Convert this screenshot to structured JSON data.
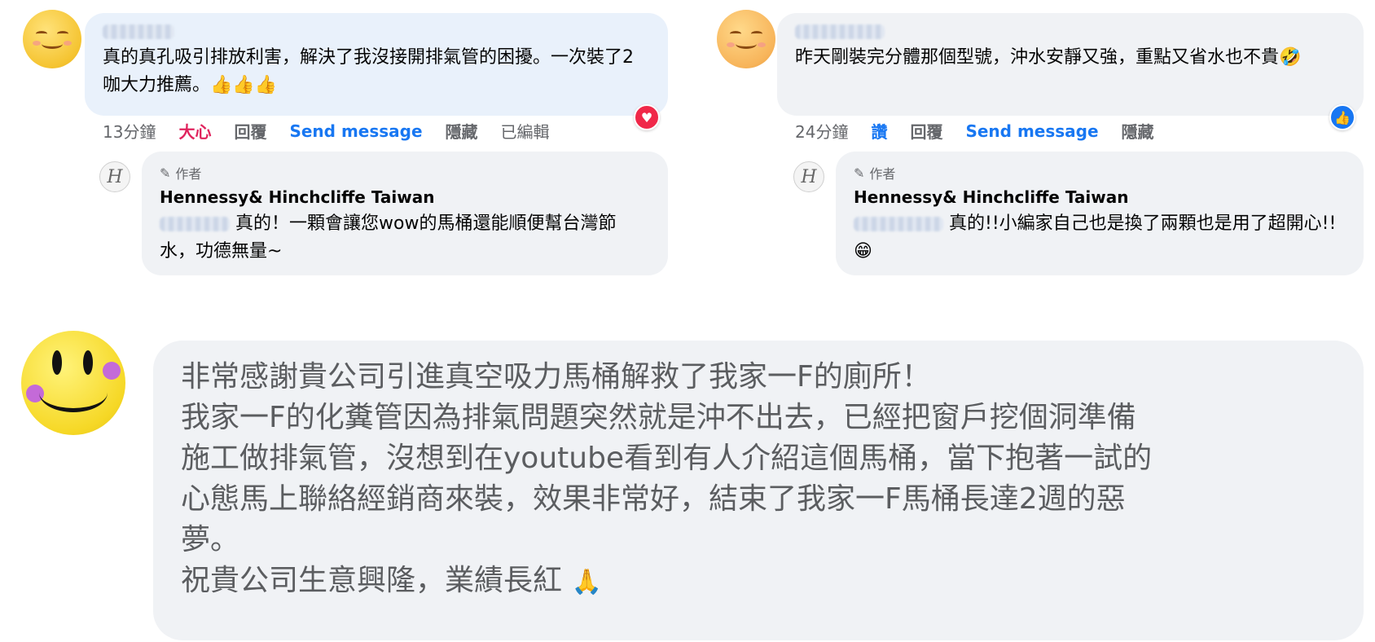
{
  "comments": [
    {
      "text": "真的真孔吸引排放利害，解決了我沒接開排氣管的困擾。一次裝了2咖大力推薦。👍👍👍",
      "time": "13分鐘",
      "reaction_label": "大心",
      "reply_label": "回覆",
      "send_label": "Send message",
      "hide_label": "隱藏",
      "edited_label": "已編輯",
      "reaction_badge": "heart-icon"
    },
    {
      "text": "昨天剛裝完分體那個型號，沖水安靜又強，重點又省水也不貴🤣",
      "time": "24分鐘",
      "reaction_label": "讚",
      "reply_label": "回覆",
      "send_label": "Send message",
      "hide_label": "隱藏",
      "reaction_badge": "thumbs-up-icon"
    }
  ],
  "replies": [
    {
      "author_badge": "作者",
      "page_name": "Hennessy& Hinchcliffe Taiwan",
      "text": "真的！一顆會讓您wow的馬桶還能順便幫台灣節水，功德無量~"
    },
    {
      "author_badge": "作者",
      "page_name": "Hennessy& Hinchcliffe Taiwan",
      "text": "真的!!小編家自己也是換了兩顆也是用了超開心!!😁"
    }
  ],
  "big_comment": {
    "lines": [
      "非常感謝貴公司引進真空吸力馬桶解救了我家一F的廁所！",
      "我家一F的化糞管因為排氣問題突然就是沖不出去，已經把窗戶挖個洞準備",
      "施工做排氣管，沒想到在youtube看到有人介紹這個馬桶，當下抱著一試的",
      "心態馬上聯絡經銷商來裝，效果非常好，結束了我家一F馬桶長達2週的惡",
      "夢。",
      "祝貴公司生意興隆，業績長紅"
    ],
    "end_emoji": "🙏"
  },
  "colors": {
    "link_blue": "#1877f2",
    "love_red": "#e0245e",
    "bubble_blue": "#e9f1fb",
    "bubble_gray": "#f0f2f5"
  }
}
